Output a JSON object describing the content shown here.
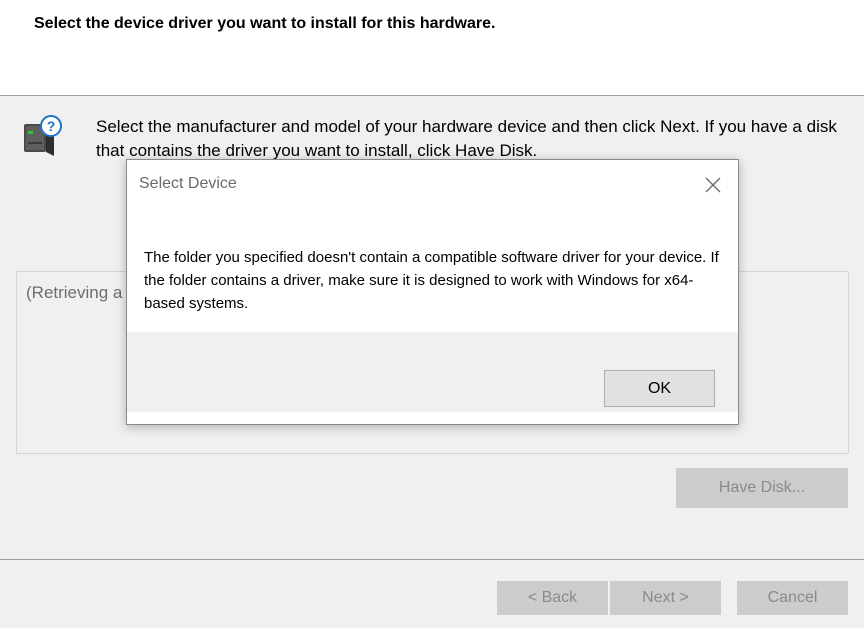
{
  "wizard": {
    "title": "Select the device driver you want to install for this hardware.",
    "instruction": "Select the manufacturer and model of your hardware device and then click Next. If you have a disk that contains the driver you want to install, click Have Disk.",
    "list_status": "(Retrieving a",
    "have_disk_label": "Have Disk...",
    "back_label": "< Back",
    "next_label": "Next >",
    "cancel_label": "Cancel",
    "icon": "hardware-question-icon"
  },
  "dialog": {
    "title": "Select Device",
    "message": "The folder you specified doesn't contain a compatible software driver for your device. If the folder contains a driver, make sure it is designed to work with Windows for x64-based systems.",
    "ok_label": "OK",
    "close_icon": "close-icon"
  },
  "colors": {
    "window_bg": "#f0f0f0",
    "header_bg": "#ffffff",
    "disabled_button_bg": "#cccccc",
    "disabled_text": "#8a8a8a",
    "ok_button_bg": "#e1e1e1",
    "icon_accent": "#1e74c8"
  }
}
